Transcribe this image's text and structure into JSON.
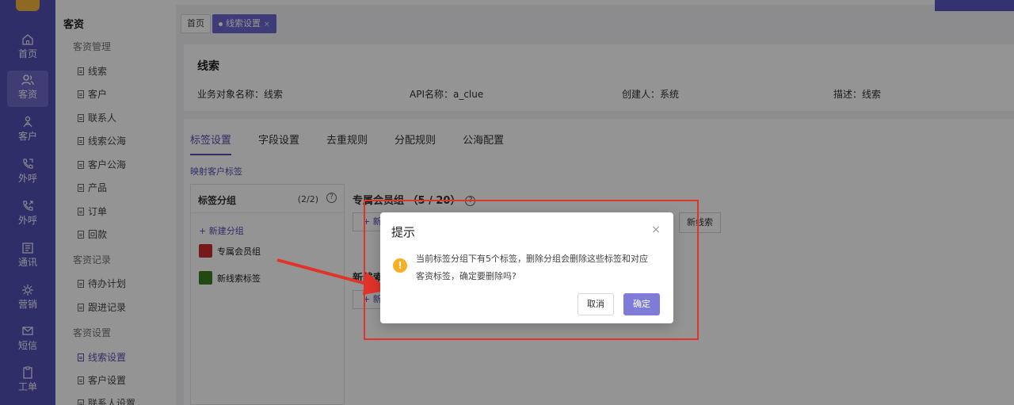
{
  "rail": {
    "items": [
      {
        "label": "首页",
        "icon": "home-icon"
      },
      {
        "label": "客资",
        "icon": "users-icon"
      },
      {
        "label": "客户",
        "icon": "customer-icon"
      },
      {
        "label": "外呼",
        "icon": "phone-icon"
      },
      {
        "label": "外呼",
        "icon": "phone-out-icon"
      },
      {
        "label": "通讯",
        "icon": "contacts-icon"
      },
      {
        "label": "营销",
        "icon": "marketing-icon"
      },
      {
        "label": "短信",
        "icon": "sms-icon"
      },
      {
        "label": "工单",
        "icon": "ticket-icon"
      }
    ]
  },
  "menu": {
    "title": "客资",
    "groups": {
      "g1": "客资管理",
      "g2": "客资记录",
      "g3": "客资设置"
    },
    "items": [
      "线索",
      "客户",
      "联系人",
      "线索公海",
      "客户公海",
      "产品",
      "订单",
      "回款",
      "待办计划",
      "跟进记录",
      "线索设置",
      "客户设置",
      "联系人设置"
    ]
  },
  "tabsbar": {
    "home": "首页",
    "current": "线索设置",
    "close": "×"
  },
  "info": {
    "title": "线索",
    "object_name": "业务对象名称：线索",
    "api_name": "API名称：a_clue",
    "creator": "创建人：系统",
    "desc": "描述：线索"
  },
  "main": {
    "tabs": [
      "标签设置",
      "字段设置",
      "去重规则",
      "分配规则",
      "公海配置"
    ],
    "map_link": "映射客户标签",
    "group_panel": {
      "title": "标签分组",
      "count": "(2/2)",
      "help": "?",
      "new_group": "+ 新建分组",
      "groups": [
        {
          "name": "专属会员组",
          "color": "#c9302c"
        },
        {
          "name": "新线索标签",
          "color": "#3b7d23"
        }
      ]
    },
    "right": {
      "title1": "专属会员组 （5 / 20）",
      "help": "?",
      "plus1": "+ 新",
      "chip": "新线索",
      "title2": "新线索",
      "plus2": "+ 新"
    }
  },
  "dialog": {
    "title": "提示",
    "close": "×",
    "warn": "!",
    "message": "当前标签分组下有5个标签，删除分组会删除这些标签和对应客资标签，确定要删除吗?",
    "cancel": "取消",
    "ok": "确定"
  },
  "colors": {
    "brand": "#5450b4",
    "annotation": "#e0342a",
    "warning": "#f5b026"
  }
}
